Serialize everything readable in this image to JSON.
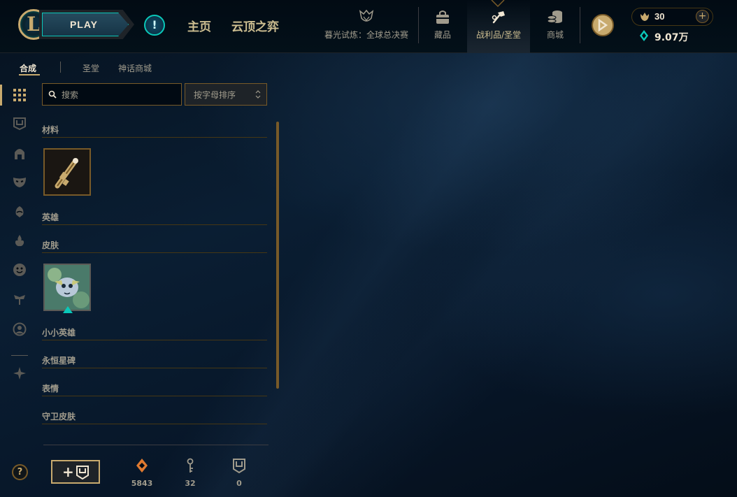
{
  "topbar": {
    "play_label": "PLAY",
    "nav_home": "主页",
    "nav_tft": "云顶之弈",
    "nav_event": "暮光试炼：全球总决赛",
    "nav_collection": "藏品",
    "nav_loot": "战利品/圣堂",
    "nav_store": "商城",
    "rp_value": "30",
    "be_value": "9.07万"
  },
  "subnav": {
    "tab_craft": "合成",
    "tab_sanctum": "圣堂",
    "tab_mythic": "神话商城"
  },
  "search": {
    "placeholder": "搜索",
    "sort_label": "按字母排序"
  },
  "categories": {
    "materials": "材料",
    "champions": "英雄",
    "skins": "皮肤",
    "little_legends": "小小英雄",
    "eternals": "永恒星碑",
    "emotes": "表情",
    "ward_skins": "守卫皮肤"
  },
  "bottom": {
    "orange_essence": "5843",
    "keys": "32",
    "chests": "0"
  },
  "colors": {
    "gold": "#c8aa6e",
    "teal": "#0ac8b9",
    "text": "#a09b8c",
    "bg": "#010a13"
  },
  "icons": {
    "rail": [
      "grid-icon",
      "chest-icon",
      "champion-icon",
      "skin-mask-icon",
      "ward-icon",
      "little-legend-icon",
      "emote-icon",
      "icon-icon",
      "summoner-icon",
      "eternals-icon"
    ]
  }
}
